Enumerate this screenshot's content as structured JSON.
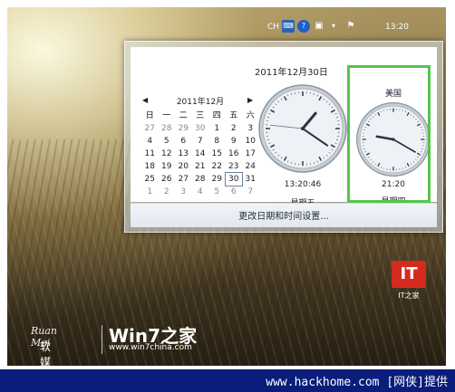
{
  "taskbar": {
    "lang": "CH",
    "time": "13:20",
    "icons": [
      "keyboard-icon",
      "help-icon",
      "network-icon",
      "volume-icon",
      "flag-icon"
    ]
  },
  "flyout": {
    "date_title": "2011年12月30日",
    "calendar": {
      "month_label": "2011年12月",
      "weekdays": [
        "日",
        "一",
        "二",
        "三",
        "四",
        "五",
        "六"
      ],
      "weeks": [
        [
          "27",
          "28",
          "29",
          "30",
          "1",
          "2",
          "3"
        ],
        [
          "4",
          "5",
          "6",
          "7",
          "8",
          "9",
          "10"
        ],
        [
          "11",
          "12",
          "13",
          "14",
          "15",
          "16",
          "17"
        ],
        [
          "18",
          "19",
          "20",
          "21",
          "22",
          "23",
          "24"
        ],
        [
          "25",
          "26",
          "27",
          "28",
          "29",
          "30",
          "31"
        ],
        [
          "1",
          "2",
          "3",
          "4",
          "5",
          "6",
          "7"
        ]
      ],
      "selected_day": "30"
    },
    "clocks": [
      {
        "name": "",
        "time": "13:20:46",
        "day": "星期五",
        "hour": 13,
        "minute": 20,
        "second": 46
      },
      {
        "name": "美国",
        "time": "21:20",
        "day": "星期四",
        "hour": 21,
        "minute": 20
      }
    ],
    "footer_link": "更改日期和时间设置..."
  },
  "desktop": {
    "it_logo": "IT",
    "it_label": "IT之家",
    "brand_rubo": "Ruan Mei",
    "brand_cn": "软媒",
    "brand_win7": "Win7之家",
    "brand_url": "www.win7china.com"
  },
  "watermark": "www.hackhome.com [网侠]提供",
  "colors": {
    "highlight": "#52c64a",
    "banner": "#0a1d7a"
  }
}
